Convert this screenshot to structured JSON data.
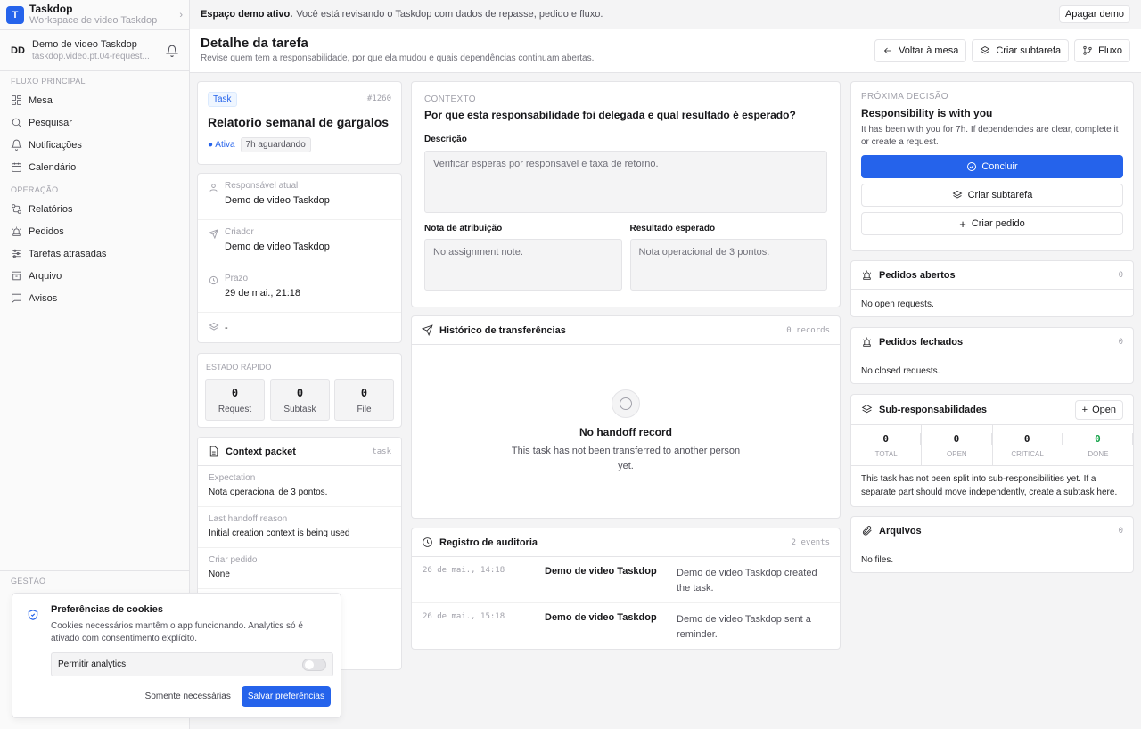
{
  "app": {
    "name": "Taskdop",
    "workspace": "Workspace de video Taskdop",
    "logo_letter": "T"
  },
  "user": {
    "initials": "DD",
    "name": "Demo de video Taskdop",
    "email": "taskdop.video.pt.04-request..."
  },
  "nav": {
    "sec1": "FLUXO PRINCIPAL",
    "main": [
      {
        "label": "Mesa",
        "icon": "layout-icon"
      },
      {
        "label": "Pesquisar",
        "icon": "search-icon"
      },
      {
        "label": "Notificações",
        "icon": "bell-icon"
      },
      {
        "label": "Calendário",
        "icon": "calendar-icon"
      }
    ],
    "sec2": "OPERAÇÃO",
    "ops": [
      {
        "label": "Relatórios",
        "icon": "route-icon"
      },
      {
        "label": "Pedidos",
        "icon": "alarm-icon"
      },
      {
        "label": "Tarefas atrasadas",
        "icon": "sliders-icon"
      },
      {
        "label": "Arquivo",
        "icon": "archive-icon"
      },
      {
        "label": "Avisos",
        "icon": "message-icon"
      }
    ],
    "sec3": "GESTÃO"
  },
  "banner": {
    "strong": "Espaço demo ativo.",
    "text": "Você está revisando o Taskdop com dados de repasse, pedido e fluxo.",
    "button": "Apagar demo"
  },
  "header": {
    "title": "Detalhe da tarefa",
    "subtitle": "Revise quem tem a responsabilidade, por que ela mudou e quais dependências continuam abertas.",
    "back": "Voltar à mesa",
    "subtask": "Criar subtarefa",
    "flow": "Fluxo"
  },
  "task": {
    "type": "Task",
    "id": "#1260",
    "title": "Relatorio semanal de gargalos",
    "status": "Ativa",
    "waiting": "7h aguardando"
  },
  "details": {
    "resp_label": "Responsável atual",
    "resp": "Demo de video Taskdop",
    "creator_label": "Criador",
    "creator": "Demo de video Taskdop",
    "due_label": "Prazo",
    "due": "29 de mai., 21:18",
    "extra": "-"
  },
  "quick": {
    "title": "ESTADO RÁPIDO",
    "request": {
      "n": "0",
      "t": "Request"
    },
    "subtask": {
      "n": "0",
      "t": "Subtask"
    },
    "file": {
      "n": "0",
      "t": "File"
    }
  },
  "context": {
    "title": "Context packet",
    "tag": "task",
    "exp_label": "Expectation",
    "exp": "Nota operacional de 3 pontos.",
    "handoff_label": "Last handoff reason",
    "handoff": "Initial creation context is being used",
    "req_label": "Criar pedido",
    "req": "None"
  },
  "contexto": {
    "eyebrow": "CONTEXTO",
    "question": "Por que esta responsabilidade foi delegada e qual resultado é esperado?",
    "desc_label": "Descrição",
    "desc": "Verificar esperas por responsavel e taxa de retorno.",
    "note_label": "Nota de atribuição",
    "note": "No assignment note.",
    "result_label": "Resultado esperado",
    "result": "Nota operacional de 3 pontos."
  },
  "history": {
    "title": "Histórico de transferências",
    "count": "0 records",
    "empty_title": "No handoff record",
    "empty_text": "This task has not been transferred to another person yet."
  },
  "audit": {
    "title": "Registro de auditoria",
    "count": "2 events",
    "rows": [
      {
        "date": "26 de mai., 14:18",
        "who": "Demo de video Taskdop",
        "event": "Demo de video Taskdop created the task."
      },
      {
        "date": "26 de mai., 15:18",
        "who": "Demo de video Taskdop",
        "event": "Demo de video Taskdop sent a reminder."
      }
    ]
  },
  "decision": {
    "eyebrow": "PRÓXIMA DECISÃO",
    "title": "Responsibility is with you",
    "text": "It has been with you for 7h. If dependencies are clear, complete it or create a request.",
    "complete": "Concluir",
    "subtask": "Criar subtarefa",
    "request": "Criar pedido"
  },
  "open_requests": {
    "title": "Pedidos abertos",
    "count": "0",
    "empty": "No open requests."
  },
  "closed_requests": {
    "title": "Pedidos fechados",
    "count": "0",
    "empty": "No closed requests."
  },
  "subresp": {
    "title": "Sub-responsabilidades",
    "open_btn": "Open",
    "total": {
      "n": "0",
      "t": "TOTAL"
    },
    "open": {
      "n": "0",
      "t": "OPEN"
    },
    "critical": {
      "n": "0",
      "t": "CRITICAL"
    },
    "done": {
      "n": "0",
      "t": "DONE"
    },
    "text": "This task has not been split into sub-responsibilities yet. If a separate part should move independently, create a subtask here."
  },
  "files": {
    "title": "Arquivos",
    "count": "0",
    "empty": "No files."
  },
  "cookies": {
    "title": "Preferências de cookies",
    "text": "Cookies necessários mantêm o app funcionando. Analytics só é ativado com consentimento explícito.",
    "analytics": "Permitir analytics",
    "necessary": "Somente necessárias",
    "save": "Salvar preferências"
  },
  "colors": {
    "accent": "#2563eb",
    "done": "#16a34a",
    "status": "#2563eb"
  }
}
